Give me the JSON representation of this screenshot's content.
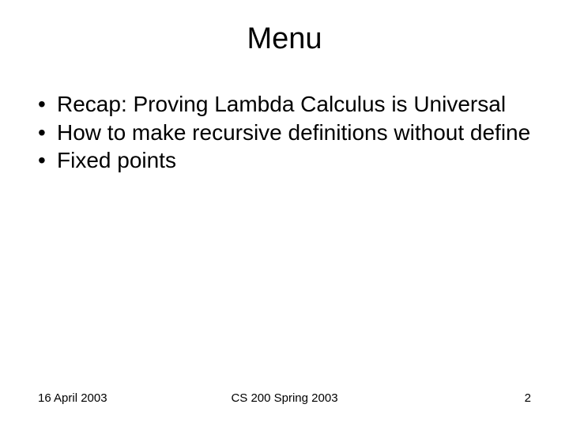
{
  "title": "Menu",
  "bullets": [
    "Recap: Proving Lambda Calculus is Universal",
    "How to make recursive definitions without define",
    "Fixed points"
  ],
  "footer": {
    "date": "16 April 2003",
    "course": "CS 200 Spring 2003",
    "page": "2"
  }
}
